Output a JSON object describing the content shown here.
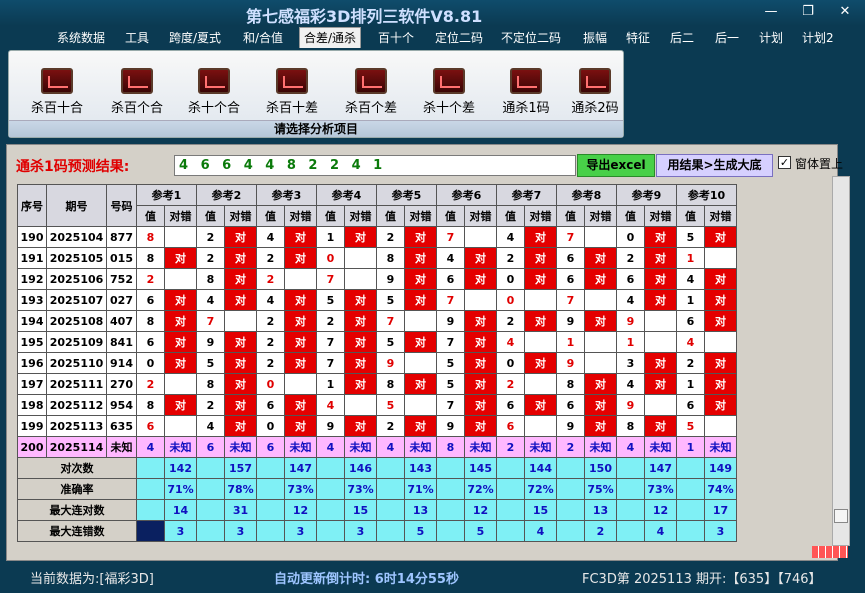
{
  "app": {
    "title": "第七感福彩3D排列三软件V8.81"
  },
  "menu": [
    "系统数据",
    "工具",
    "跨度/夏式",
    "和/合值",
    "合差/通杀",
    "百十个",
    "定位二码",
    "不定位二码",
    "振幅",
    "特征",
    "后二",
    "后一",
    "计划",
    "计划2"
  ],
  "menu_active_index": 4,
  "ribbon": {
    "buttons": [
      "杀百十合",
      "杀百个合",
      "杀十个合",
      "杀百十差",
      "杀百个差",
      "杀十个差",
      "通杀1码",
      "通杀2码"
    ],
    "footer": "请选择分析项目"
  },
  "prediction": {
    "label": "通杀1码预测结果:",
    "value": "4 6 6 4 4 8 2 2 4 1",
    "export_button": "导出excel",
    "generate_button": "用结果>生成大底",
    "checkbox_label": "窗体置上",
    "checkbox_checked": true
  },
  "table": {
    "col_headers": [
      "序号",
      "期号",
      "号码"
    ],
    "ref_headers": [
      "参考1",
      "参考2",
      "参考3",
      "参考4",
      "参考5",
      "参考6",
      "参考7",
      "参考8",
      "参考9",
      "参考10"
    ],
    "sub_headers": [
      "值",
      "对错"
    ],
    "rows": [
      {
        "seq": "190",
        "issue": "2025104",
        "num": "877",
        "v": [
          "8",
          "2",
          "4",
          "1",
          "2",
          "7",
          "4",
          "7",
          "0",
          "5"
        ],
        "ok": [
          1,
          0,
          0,
          0,
          0,
          1,
          0,
          1,
          0,
          0
        ],
        "red": [
          1,
          0,
          0,
          0,
          0,
          1,
          0,
          1,
          0,
          0
        ]
      },
      {
        "seq": "191",
        "issue": "2025105",
        "num": "015",
        "v": [
          "8",
          "2",
          "2",
          "0",
          "8",
          "4",
          "2",
          "6",
          "2",
          "1"
        ],
        "ok": [
          0,
          0,
          0,
          1,
          0,
          0,
          0,
          0,
          0,
          1
        ],
        "red": [
          0,
          0,
          0,
          1,
          0,
          0,
          0,
          0,
          0,
          1
        ]
      },
      {
        "seq": "192",
        "issue": "2025106",
        "num": "752",
        "v": [
          "2",
          "8",
          "2",
          "7",
          "9",
          "6",
          "0",
          "6",
          "6",
          "4"
        ],
        "ok": [
          1,
          0,
          1,
          1,
          0,
          0,
          0,
          0,
          0,
          0
        ],
        "red": [
          1,
          0,
          1,
          1,
          0,
          0,
          0,
          0,
          0,
          0
        ]
      },
      {
        "seq": "193",
        "issue": "2025107",
        "num": "027",
        "v": [
          "6",
          "4",
          "4",
          "5",
          "5",
          "7",
          "0",
          "7",
          "4",
          "1"
        ],
        "ok": [
          0,
          0,
          0,
          0,
          0,
          1,
          1,
          1,
          0,
          0
        ],
        "red": [
          0,
          0,
          0,
          0,
          0,
          1,
          1,
          1,
          0,
          0
        ]
      },
      {
        "seq": "194",
        "issue": "2025108",
        "num": "407",
        "v": [
          "8",
          "7",
          "2",
          "2",
          "7",
          "9",
          "2",
          "9",
          "9",
          "6"
        ],
        "ok": [
          0,
          1,
          0,
          0,
          1,
          0,
          0,
          0,
          1,
          0
        ],
        "red": [
          0,
          1,
          0,
          0,
          1,
          0,
          0,
          0,
          1,
          0
        ]
      },
      {
        "seq": "195",
        "issue": "2025109",
        "num": "841",
        "v": [
          "6",
          "9",
          "2",
          "7",
          "5",
          "7",
          "4",
          "1",
          "1",
          "4"
        ],
        "ok": [
          0,
          0,
          0,
          0,
          0,
          0,
          1,
          1,
          1,
          1
        ],
        "red": [
          0,
          0,
          0,
          0,
          0,
          0,
          1,
          1,
          1,
          1
        ]
      },
      {
        "seq": "196",
        "issue": "2025110",
        "num": "914",
        "v": [
          "0",
          "5",
          "2",
          "7",
          "9",
          "5",
          "0",
          "9",
          "3",
          "2"
        ],
        "ok": [
          0,
          0,
          0,
          0,
          1,
          0,
          0,
          1,
          0,
          0
        ],
        "red": [
          0,
          0,
          0,
          0,
          1,
          0,
          0,
          1,
          0,
          0
        ]
      },
      {
        "seq": "197",
        "issue": "2025111",
        "num": "270",
        "v": [
          "2",
          "8",
          "0",
          "1",
          "8",
          "5",
          "2",
          "8",
          "4",
          "1"
        ],
        "ok": [
          1,
          0,
          1,
          0,
          0,
          0,
          1,
          0,
          0,
          0
        ],
        "red": [
          1,
          0,
          1,
          0,
          0,
          0,
          1,
          0,
          0,
          0
        ]
      },
      {
        "seq": "198",
        "issue": "2025112",
        "num": "954",
        "v": [
          "8",
          "2",
          "6",
          "4",
          "5",
          "7",
          "6",
          "6",
          "9",
          "6"
        ],
        "ok": [
          0,
          0,
          0,
          1,
          1,
          0,
          0,
          0,
          1,
          0
        ],
        "red": [
          0,
          0,
          0,
          1,
          1,
          0,
          0,
          0,
          1,
          0
        ]
      },
      {
        "seq": "199",
        "issue": "2025113",
        "num": "635",
        "v": [
          "6",
          "4",
          "0",
          "9",
          "2",
          "9",
          "6",
          "9",
          "8",
          "5"
        ],
        "ok": [
          1,
          0,
          0,
          0,
          0,
          0,
          1,
          0,
          0,
          1
        ],
        "red": [
          1,
          0,
          0,
          0,
          0,
          0,
          1,
          0,
          0,
          1
        ]
      }
    ],
    "ok_text": "对",
    "pred_row": {
      "seq": "200",
      "issue": "2025114",
      "num": "未知",
      "v": [
        "4",
        "6",
        "6",
        "4",
        "4",
        "8",
        "2",
        "2",
        "4",
        "1"
      ],
      "status": "未知"
    },
    "stats": [
      {
        "label": "对次数",
        "values": [
          "142",
          "157",
          "147",
          "146",
          "143",
          "145",
          "144",
          "150",
          "147",
          "149"
        ]
      },
      {
        "label": "准确率",
        "values": [
          "71%",
          "78%",
          "73%",
          "73%",
          "71%",
          "72%",
          "72%",
          "75%",
          "73%",
          "74%"
        ]
      },
      {
        "label": "最大连对数",
        "values": [
          "14",
          "31",
          "12",
          "15",
          "13",
          "12",
          "15",
          "13",
          "12",
          "17"
        ]
      },
      {
        "label": "最大连错数",
        "values": [
          "3",
          "3",
          "3",
          "3",
          "5",
          "5",
          "4",
          "2",
          "4",
          "3"
        ]
      }
    ]
  },
  "status": {
    "left": "当前数据为:[福彩3D]",
    "mid": "自动更新倒计时:  6时14分55秒",
    "right": "FC3D第 2025113 期开:【635】【746】"
  }
}
